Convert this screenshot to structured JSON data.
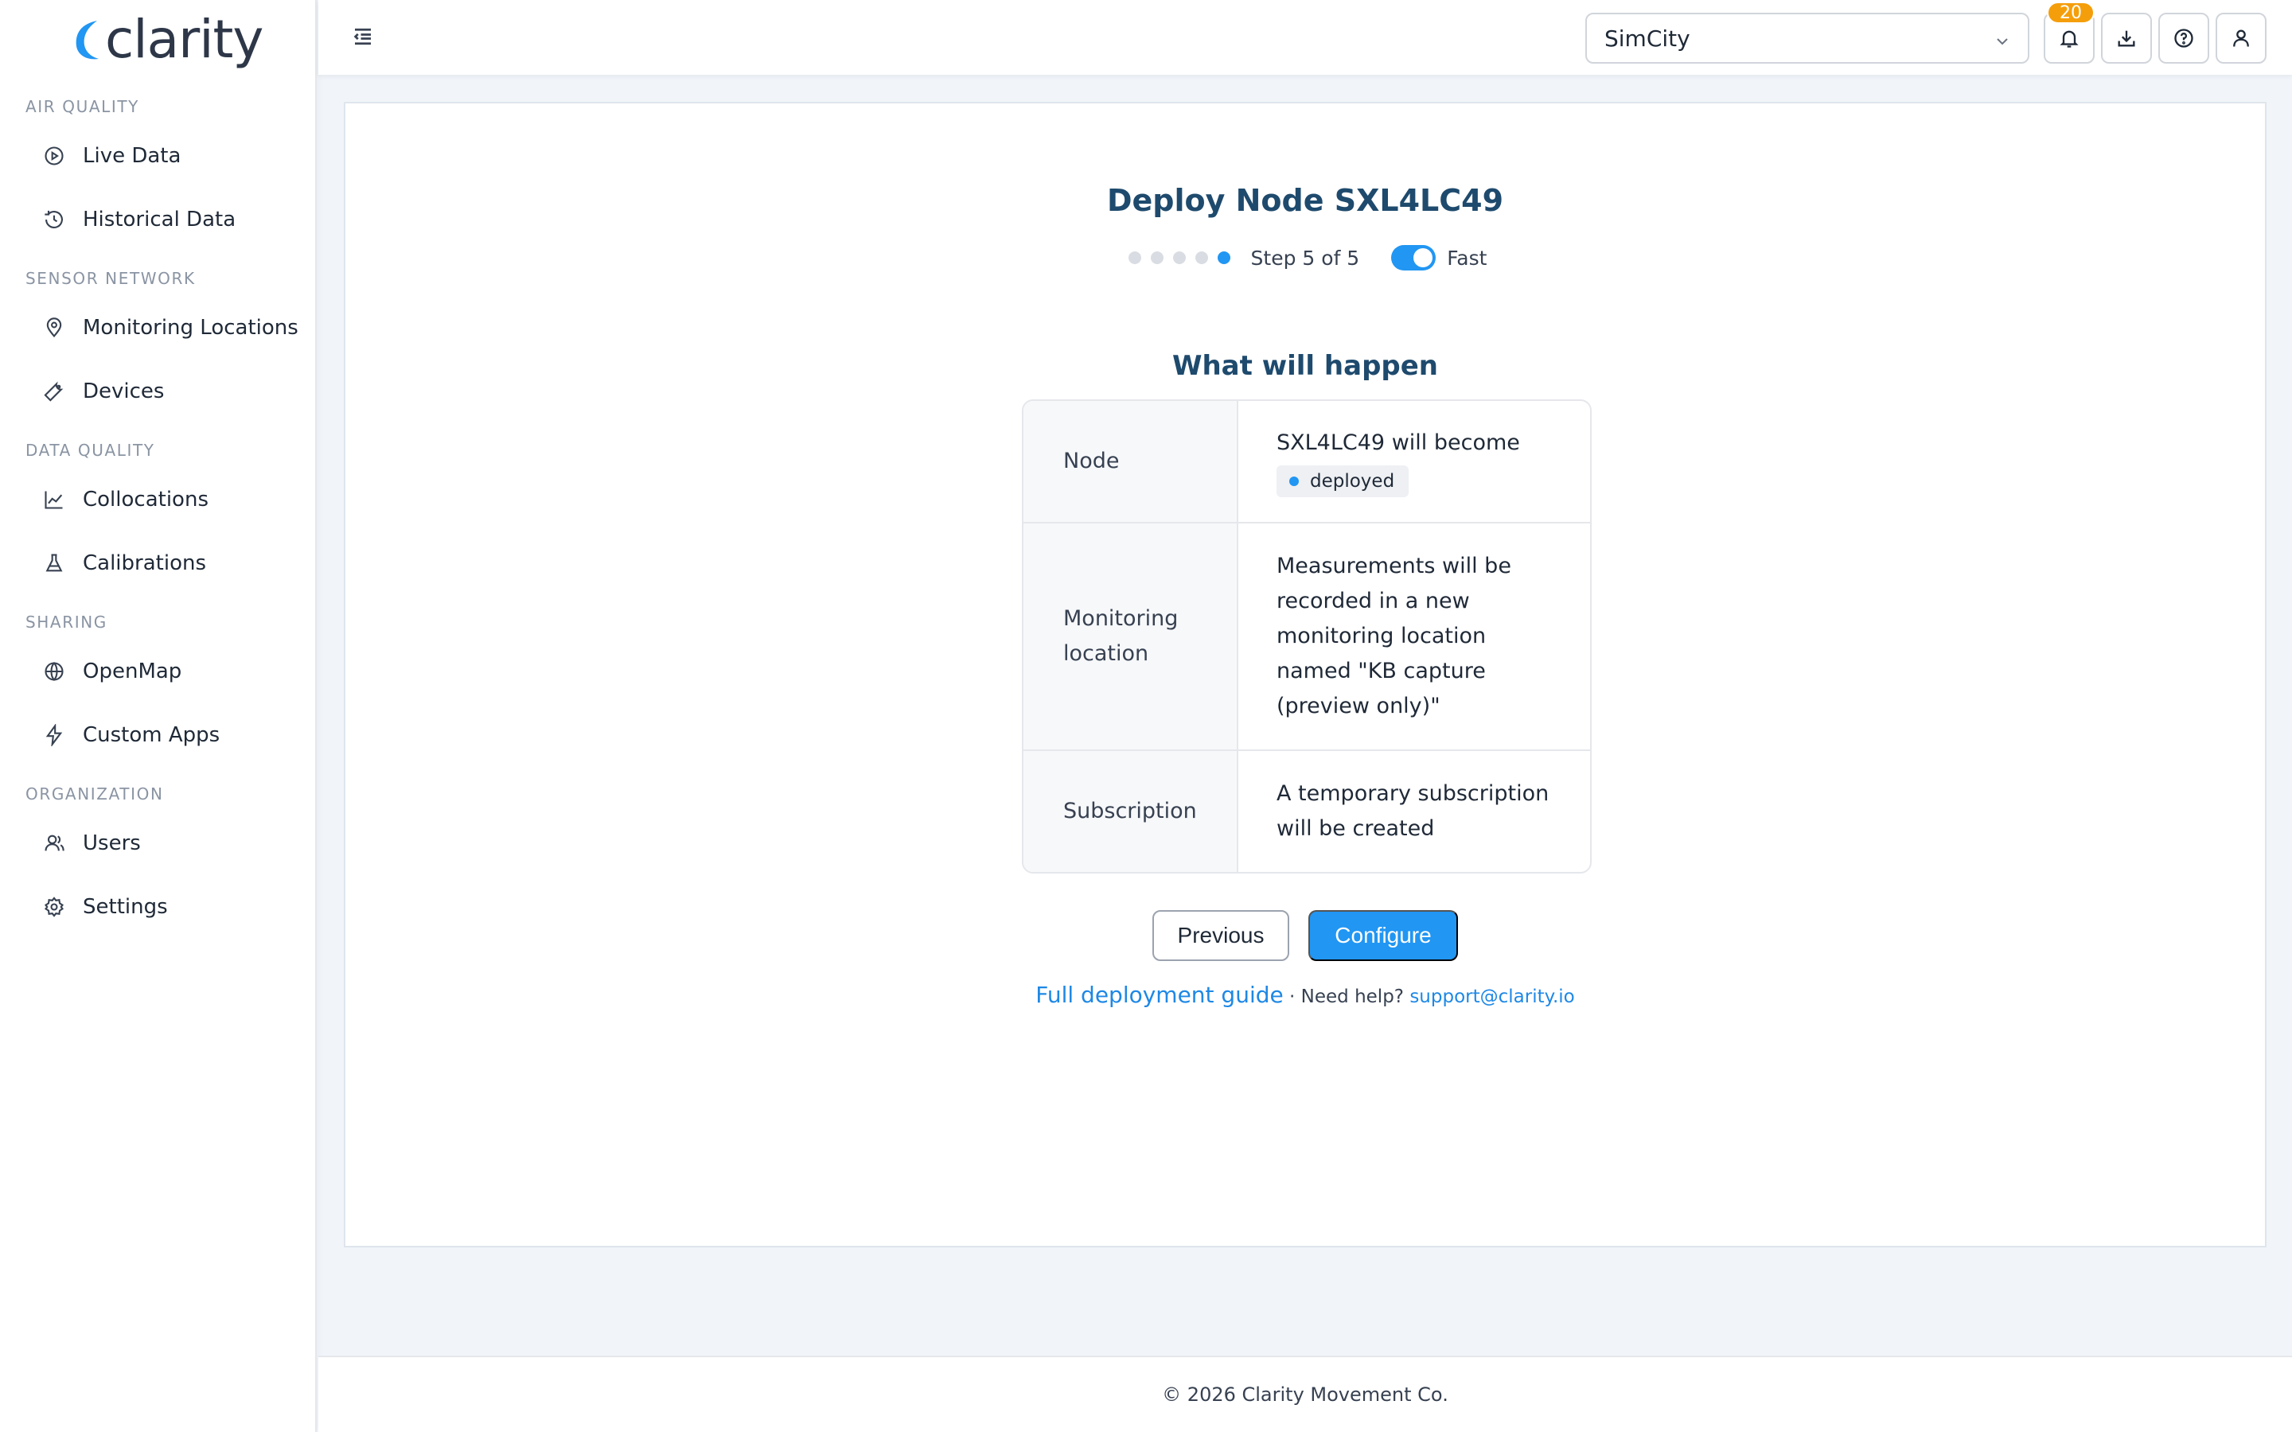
{
  "brand": {
    "name": "clarity",
    "accent": "#2196f3"
  },
  "sidebar": {
    "sections": [
      {
        "title": "AIR QUALITY",
        "items": [
          {
            "label": "Live Data",
            "icon": "play-circle-icon"
          },
          {
            "label": "Historical Data",
            "icon": "clock-icon"
          }
        ]
      },
      {
        "title": "SENSOR NETWORK",
        "items": [
          {
            "label": "Monitoring Locations",
            "icon": "map-pin-icon"
          },
          {
            "label": "Devices",
            "icon": "wrench-icon"
          }
        ]
      },
      {
        "title": "DATA QUALITY",
        "items": [
          {
            "label": "Collocations",
            "icon": "line-chart-icon"
          },
          {
            "label": "Calibrations",
            "icon": "flask-icon"
          }
        ]
      },
      {
        "title": "SHARING",
        "items": [
          {
            "label": "OpenMap",
            "icon": "globe-icon"
          },
          {
            "label": "Custom Apps",
            "icon": "lightning-icon"
          }
        ]
      },
      {
        "title": "ORGANIZATION",
        "items": [
          {
            "label": "Users",
            "icon": "users-icon"
          },
          {
            "label": "Settings",
            "icon": "gear-icon"
          }
        ]
      }
    ]
  },
  "topbar": {
    "org_select": {
      "value": "SimCity"
    },
    "notifications_count": "20"
  },
  "wizard": {
    "title": "Deploy Node SXL4LC49",
    "step_text": "Step 5 of 5",
    "current_step": 5,
    "total_steps": 5,
    "fast_mode_label": "Fast",
    "fast_mode_on": true,
    "subtitle": "What will happen",
    "rows": [
      {
        "key": "Node",
        "value": "SXL4LC49 will become",
        "pill": "deployed"
      },
      {
        "key": "Monitoring location",
        "value": "Measurements will be recorded in a new monitoring location named \"KB capture (preview only)\""
      },
      {
        "key": "Subscription",
        "value": "A temporary subscription will be created"
      }
    ],
    "previous_label": "Previous",
    "configure_label": "Configure",
    "guide_link": "Full deployment guide",
    "help_text": " · Need help? ",
    "support_link": "support@clarity.io"
  },
  "footer": {
    "text": "© 2026 Clarity Movement Co."
  }
}
